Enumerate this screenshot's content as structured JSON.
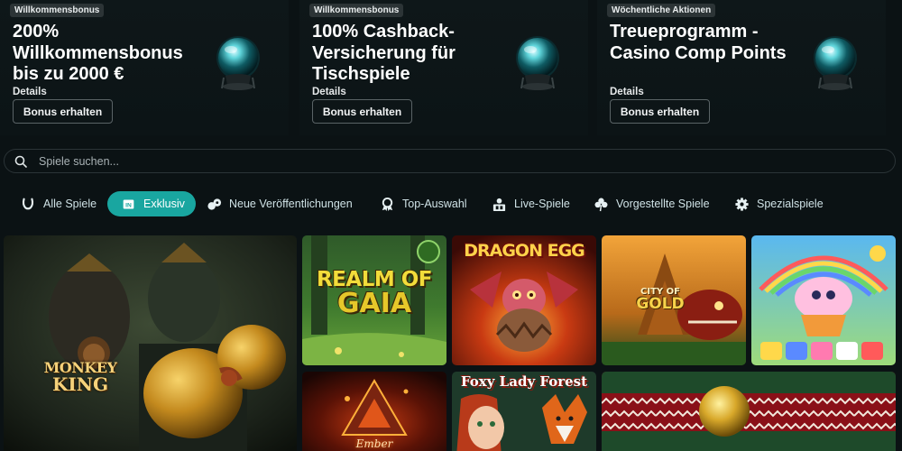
{
  "promos": [
    {
      "badge": "Willkommensbonus",
      "title": "200% Willkommensbonus bis zu 2000 €",
      "details": "Details",
      "button": "Bonus erhalten"
    },
    {
      "badge": "Willkommensbonus",
      "title": "100% Cashback-Versicherung für Tischspiele",
      "details": "Details",
      "button": "Bonus erhalten"
    },
    {
      "badge": "Wöchentliche Aktionen",
      "title": "Treueprogramm - Casino Comp Points",
      "details": "Details",
      "button": "Bonus erhalten"
    }
  ],
  "search": {
    "placeholder": "Spiele suchen..."
  },
  "tabs": [
    {
      "label": "Alle Spiele",
      "icon": "horseshoe-icon"
    },
    {
      "label": "Exklusiv",
      "icon": "exclusive-icon",
      "active": true
    },
    {
      "label": "Neue Veröffentlichungen",
      "icon": "new-releases-icon"
    },
    {
      "label": "Top-Auswahl",
      "icon": "award-icon"
    },
    {
      "label": "Live-Spiele",
      "icon": "live-dealer-icon"
    },
    {
      "label": "Vorgestellte Spiele",
      "icon": "clover-icon"
    },
    {
      "label": "Spezialspiele",
      "icon": "gear-icon"
    }
  ],
  "games": {
    "monkey_king": {
      "line1": "MONKEY",
      "line2": "KING"
    },
    "realm_of_gaia": {
      "line1": "REALM OF",
      "line2": "GAIA"
    },
    "dragon_egg": {
      "line1": "DRAGON",
      "line2": "EGG"
    },
    "city_of_gold": {
      "line1": "CITY OF",
      "line2": "GOLD"
    },
    "candy": {
      "title": ""
    },
    "ember": {
      "title": "Ember"
    },
    "foxy_lady_forest": {
      "title": "Foxy Lady Forest"
    }
  },
  "colors": {
    "accent": "#19a6a0",
    "background": "#0b1214"
  }
}
